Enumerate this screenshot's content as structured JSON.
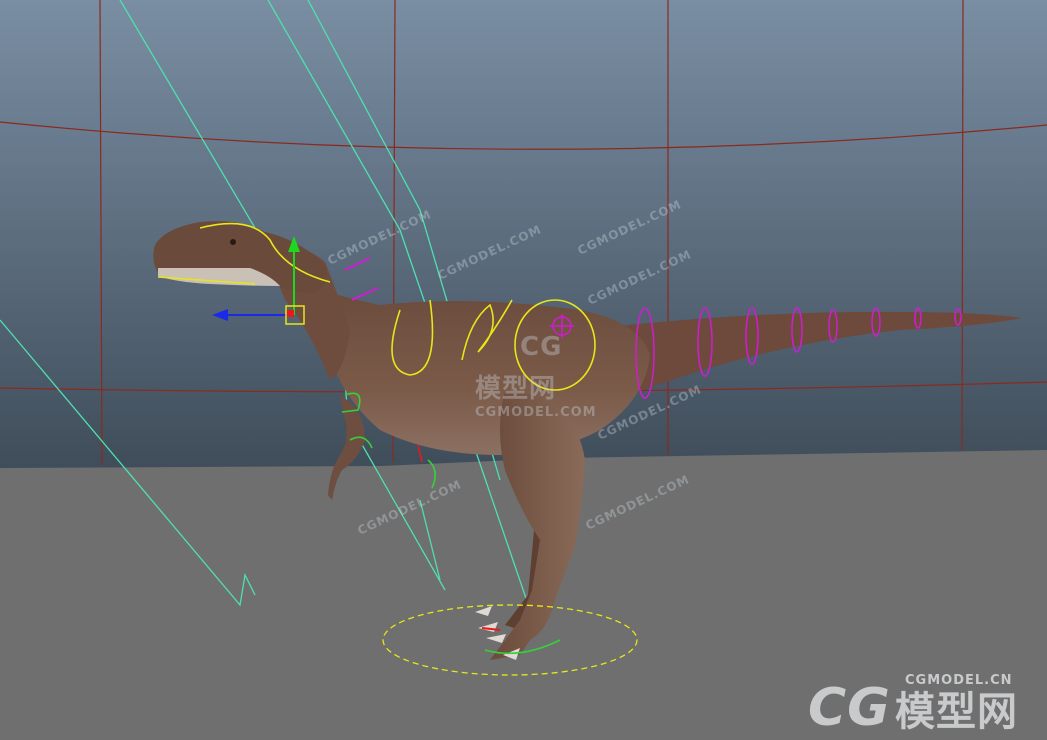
{
  "viewport": {
    "background_top_color": "#7a8ea3",
    "background_bottom_color": "#3f4d5a",
    "ground_color": "#6f6f6f",
    "grid_color": "#8a2a1f"
  },
  "rig": {
    "dinosaur_skin_color": "#7a5a48",
    "curve_color_yellow": "#e8e61a",
    "curve_color_magenta": "#d21bd2",
    "curve_color_green": "#36d13a",
    "ik_line_color": "#4fe0b0",
    "manipulator_y_color": "#1ed81e",
    "manipulator_z_color": "#1a2ae8",
    "manipulator_center_color": "#e81a1a"
  },
  "watermarks": {
    "diagonal_text": "CGMODEL.COM",
    "center_logo": "CG",
    "center_cn": "模型网",
    "center_sub": "CGMODEL.COM",
    "corner_logo": "CG",
    "corner_cn": "模型网",
    "corner_domain": "CGMODEL.CN"
  }
}
